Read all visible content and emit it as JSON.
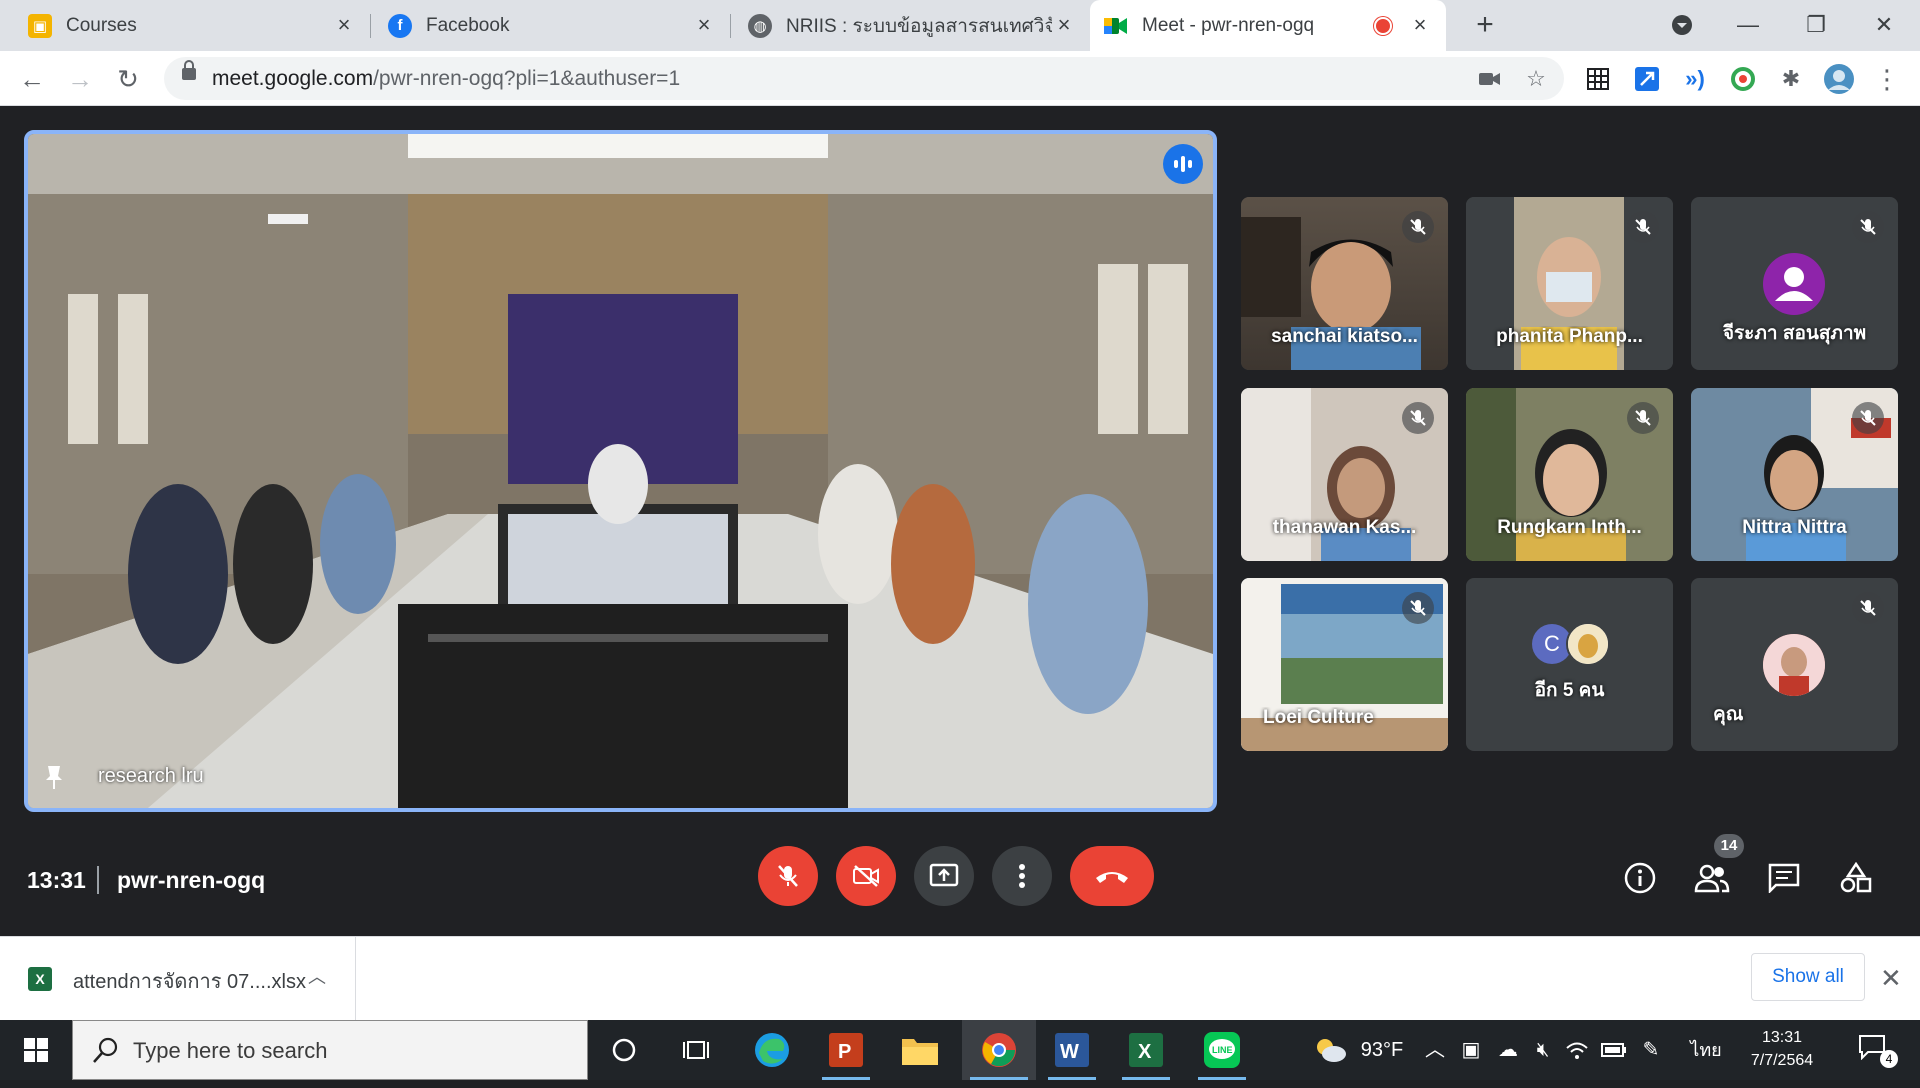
{
  "browser": {
    "tabs": [
      {
        "title": "Courses",
        "favicon_color": "#f4b400",
        "favicon_glyph": "▣",
        "active": false
      },
      {
        "title": "Facebook",
        "favicon_color": "#1877f2",
        "favicon_glyph": "f",
        "active": false
      },
      {
        "title": "NRIIS : ระบบข้อมูลสารสนเทศวิจัยและนวัตกรรม",
        "favicon_color": "#5f6368",
        "favicon_glyph": "◍",
        "active": false
      },
      {
        "title": "Meet - pwr-nren-ogq",
        "favicon_color": "#00832d",
        "favicon_glyph": "▶",
        "active": true
      }
    ],
    "url_host": "meet.google.com",
    "url_path": "/pwr-nren-ogq?pli=1&authuser=1"
  },
  "meet": {
    "main_participant": "research lru",
    "participants": [
      {
        "name": "sanchai kiatso...",
        "muted": true,
        "kind": "video",
        "bg": "#5b5147"
      },
      {
        "name": "phanita Phanp...",
        "muted": true,
        "kind": "video",
        "bg": "#b3a993"
      },
      {
        "name": "จีระภา สอนสุภาพ",
        "muted": true,
        "kind": "avatar",
        "bg": "#3c4043",
        "avatar_color": "#8e24aa"
      },
      {
        "name": "thanawan Kas...",
        "muted": true,
        "kind": "video",
        "bg": "#cfc6bc"
      },
      {
        "name": "Rungkarn Inth...",
        "muted": true,
        "kind": "video",
        "bg": "#7e8063"
      },
      {
        "name": "Nittra Nittra",
        "muted": true,
        "kind": "video",
        "bg": "#6e8aa2"
      },
      {
        "name": "Loei Culture",
        "muted": true,
        "kind": "video",
        "bg": "#9fb5c2"
      },
      {
        "name": "อีก 5 คน",
        "muted": false,
        "kind": "others",
        "bg": "#3c4043",
        "avatar_letter": "C",
        "avatar_color": "#5c6bc0"
      },
      {
        "name": "คุณ",
        "muted": true,
        "kind": "self",
        "bg": "#3c4043",
        "avatar_color": "#e57373"
      }
    ],
    "time": "13:31",
    "meeting_code": "pwr-nren-ogq",
    "participant_count": "14"
  },
  "downloads": {
    "file_name": "attendการจัดการ 07....xlsx",
    "show_all": "Show all"
  },
  "taskbar": {
    "search_placeholder": "Type here to search",
    "temperature": "93°F",
    "language": "ไทย",
    "clock_time": "13:31",
    "clock_date": "7/7/2564",
    "notifications": "4"
  },
  "colors": {
    "accent_red": "#ea4335",
    "meet_bg": "#202124",
    "speaking_border": "#8ab4f8"
  }
}
